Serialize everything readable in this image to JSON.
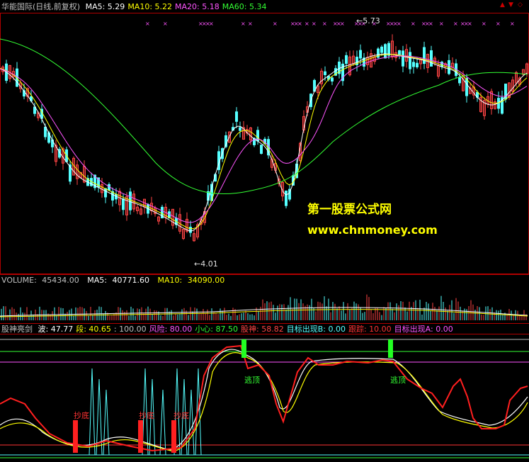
{
  "main": {
    "title": "华能国际(日线,前复权)",
    "ma_items": [
      {
        "label": "MA5:",
        "value": "5.29",
        "color": "#ffffff"
      },
      {
        "label": "MA10:",
        "value": "5.22",
        "color": "#ffff00"
      },
      {
        "label": "MA20:",
        "value": "5.18",
        "color": "#ff55ff"
      },
      {
        "label": "MA60:",
        "value": "5.34",
        "color": "#33ff33"
      }
    ],
    "high_label": "5.73",
    "low_label": "4.01",
    "watermark_title": "第一股票公式网",
    "watermark_url": "www.chnmoney.com"
  },
  "volume": {
    "label": "VOLUME:",
    "value": "45434.00",
    "ma5_label": "MA5:",
    "ma5_value": "40771.60",
    "ma10_label": "MA10:",
    "ma10_value": "34090.00"
  },
  "indicator": {
    "name": "股神亮剑",
    "items": [
      {
        "label": "波:",
        "value": "47.77",
        "color": "#ffffff"
      },
      {
        "label": "段:",
        "value": "40.65",
        "color": "#ffff00"
      },
      {
        "label": ":",
        "value": "100.00",
        "color": "#c0c0c0"
      },
      {
        "label": "风险:",
        "value": "80.00",
        "color": "#ff55ff"
      },
      {
        "label": "小心:",
        "value": "87.50",
        "color": "#33ff33"
      },
      {
        "label": "股神:",
        "value": "58.82",
        "color": "#ff4444"
      },
      {
        "label": "目标出现B:",
        "value": "0.00",
        "color": "#55ffff"
      },
      {
        "label": "跟踪:",
        "value": "10.00",
        "color": "#ff3333"
      },
      {
        "label": "目标出现A:",
        "value": "0.00",
        "color": "#ff55ff"
      }
    ],
    "buy_label": "抄底",
    "escape_label": "逃顶"
  },
  "icons": {
    "up": "triangle-up-icon",
    "down": "triangle-down-icon",
    "restore": "diamond-icon"
  },
  "colors": {
    "up_candle": "#ff4444",
    "down_candle": "#55ffff",
    "ma5": "#ffffff",
    "ma10": "#ffff00",
    "ma20": "#ff55ff",
    "ma60": "#33ff33",
    "panel_border": "#b00000",
    "gushen": "#ff1f1f",
    "buy_bar": "#ff2020",
    "sell_bar": "#22ff22"
  }
}
